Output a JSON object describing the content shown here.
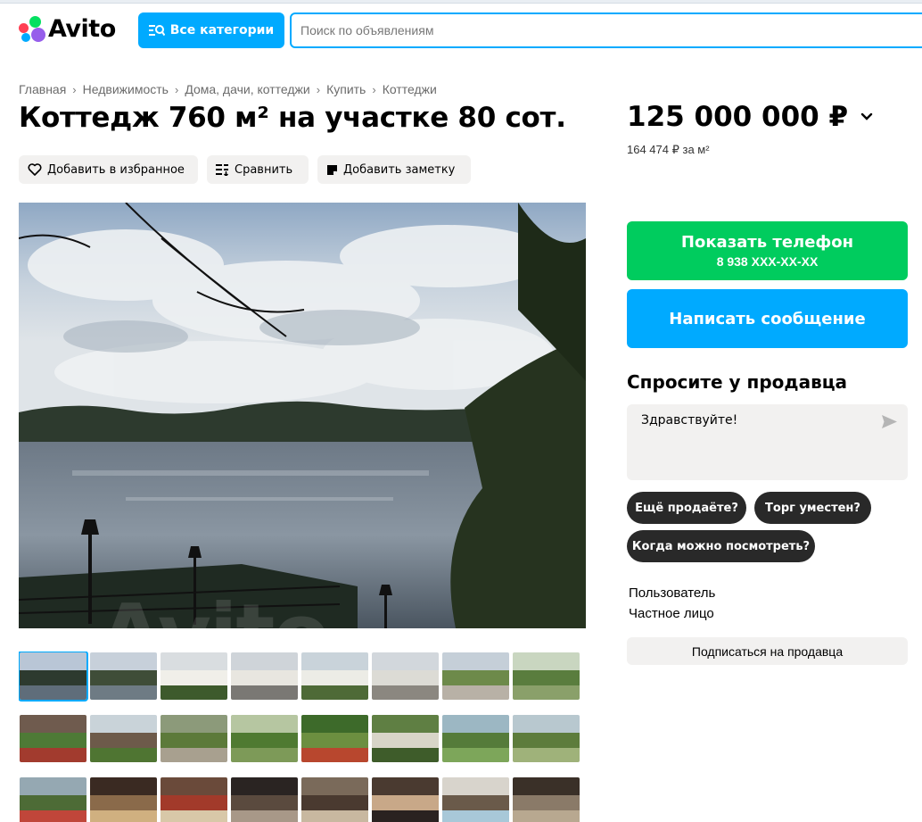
{
  "colors": {
    "accent_blue": "#00aaff",
    "green": "#00cc5e",
    "chip_dark": "#292929",
    "light_bg": "#f2f1f0"
  },
  "header": {
    "logo_text": "Avito",
    "logo_dots": [
      "#04e061",
      "#ff4053",
      "#965eeb",
      "#0af"
    ],
    "categories_label": "Все категории",
    "search_placeholder": "Поиск по объявлениям"
  },
  "breadcrumb": [
    "Главная",
    "Недвижимость",
    "Дома, дачи, коттеджи",
    "Купить",
    "Коттеджи"
  ],
  "title": "Коттедж 760 м² на участке 80 сот.",
  "actions": {
    "favorite": "Добавить в избранное",
    "compare": "Сравнить",
    "note": "Добавить заметку"
  },
  "gallery": {
    "watermark": "Avito",
    "thumbnails": [
      {
        "colors": [
          "#b9c6d6",
          "#2d3a2f",
          "#5f6d7a"
        ]
      },
      {
        "colors": [
          "#c7d0da",
          "#3f4d38",
          "#6e7b84"
        ]
      },
      {
        "colors": [
          "#d9dde0",
          "#f0efe9",
          "#3d5a2c"
        ]
      },
      {
        "colors": [
          "#cfd4d9",
          "#e8e6e0",
          "#7a7874"
        ]
      },
      {
        "colors": [
          "#c9d3da",
          "#ecece6",
          "#4e6a37"
        ]
      },
      {
        "colors": [
          "#d2d7dc",
          "#dcdbd5",
          "#8b8780"
        ]
      },
      {
        "colors": [
          "#c5cfd8",
          "#6d8a4a",
          "#b8b1a6"
        ]
      },
      {
        "colors": [
          "#c9d6c0",
          "#5a7d3e",
          "#8aa06a"
        ]
      },
      {
        "colors": [
          "#6f5b4e",
          "#4e7a36",
          "#a23b2e"
        ]
      },
      {
        "colors": [
          "#c9d3d9",
          "#6d5a4a",
          "#4f7532"
        ]
      },
      {
        "colors": [
          "#8c9a7a",
          "#5c7a3a",
          "#a8a08f"
        ]
      },
      {
        "colors": [
          "#b6c6a1",
          "#4f7a31",
          "#7d9a58"
        ]
      },
      {
        "colors": [
          "#3d6a2a",
          "#6c8f40",
          "#b8472e"
        ]
      },
      {
        "colors": [
          "#5f7f43",
          "#d8d5c8",
          "#3e5c2a"
        ]
      },
      {
        "colors": [
          "#9cb7c3",
          "#557b3a",
          "#7da65a"
        ]
      },
      {
        "colors": [
          "#b8c8cf",
          "#5d7c3c",
          "#9fb27a"
        ]
      },
      {
        "colors": [
          "#95a8b2",
          "#4d6b36",
          "#c0463a"
        ]
      },
      {
        "colors": [
          "#3a2a22",
          "#8a6a4a",
          "#d0b080"
        ]
      },
      {
        "colors": [
          "#6a4a3a",
          "#a23a2a",
          "#d8c8a8"
        ]
      },
      {
        "colors": [
          "#2a2422",
          "#5a4a3e",
          "#a89888"
        ]
      },
      {
        "colors": [
          "#7a6a5a",
          "#4a3a30",
          "#c8b8a0"
        ]
      },
      {
        "colors": [
          "#4a3a30",
          "#c8a888",
          "#2a2220"
        ]
      },
      {
        "colors": [
          "#d8d4cc",
          "#6a5a4a",
          "#a8c8d8"
        ]
      },
      {
        "colors": [
          "#3a3028",
          "#8a7a68",
          "#b8a890"
        ]
      }
    ]
  },
  "price": {
    "value": "125 000 000 ₽",
    "per_meter": "164 474 ₽ за м²"
  },
  "contact": {
    "phone_label": "Показать телефон",
    "phone_mask": "8 938 XXX-XX-XX",
    "message_label": "Написать сообщение"
  },
  "ask": {
    "title": "Спросите у продавца",
    "message_value": "Здравствуйте!",
    "chips": [
      "Ещё продаёте?",
      "Торг уместен?",
      "Когда можно посмотреть?"
    ]
  },
  "seller": {
    "role": "Пользователь",
    "type": "Частное лицо",
    "subscribe_label": "Подписаться на продавца"
  }
}
